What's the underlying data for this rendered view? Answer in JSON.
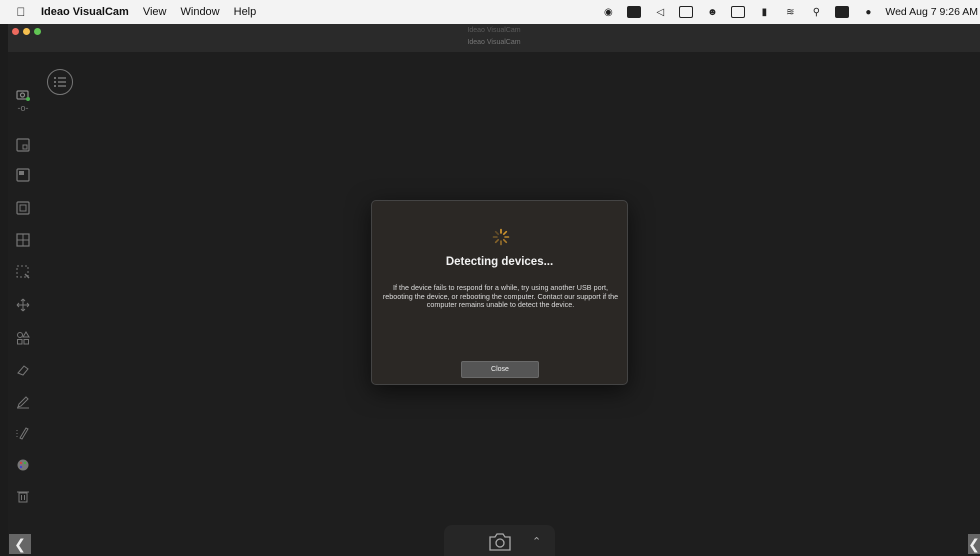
{
  "menubar": {
    "apple_icon": "apple-logo",
    "app_name": "Ideao VisualCam",
    "items": [
      "View",
      "Window",
      "Help"
    ],
    "clock": "Wed Aug 7  9:26 AM"
  },
  "window": {
    "title": "Ideao VisualCam",
    "subtitle": "Ideao VisualCam"
  },
  "toolbar": {
    "tools": [
      "camera-settings-icon",
      "picture-in-picture-icon",
      "single-view-icon",
      "focus-icon",
      "grid-view-icon",
      "crop-icon",
      "move-icon",
      "shapes-icon",
      "eraser-icon",
      "pen-icon",
      "highlighter-icon",
      "color-palette-icon",
      "trash-icon"
    ]
  },
  "dialog": {
    "title": "Detecting devices...",
    "message": "If the device fails to respond for a while, try using another USB port, rebooting the device, or rebooting the computer. Contact our support if the computer remains unable to detect the device.",
    "close_label": "Close"
  },
  "colors": {
    "background": "#1e1e1e",
    "dialog_bg": "#2b2825",
    "spinner": "#e0a030"
  }
}
